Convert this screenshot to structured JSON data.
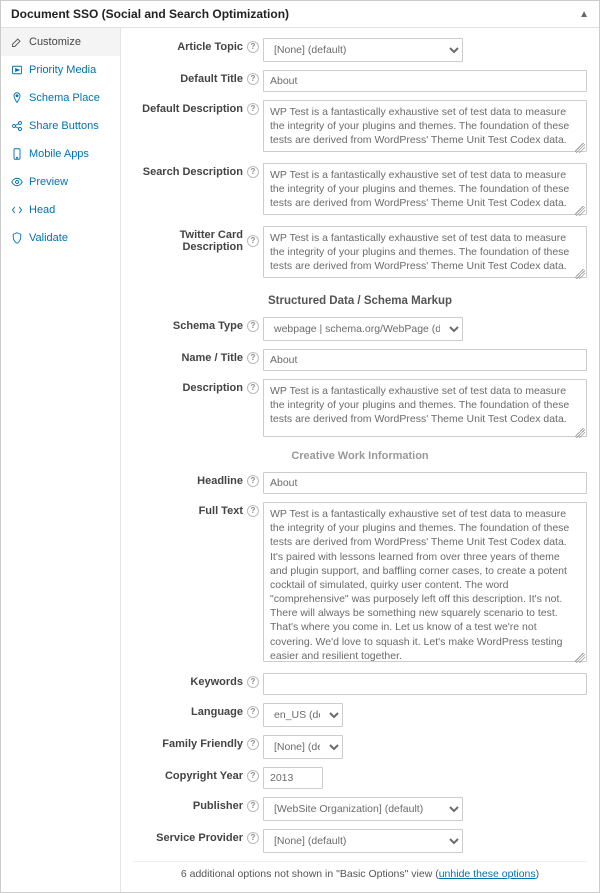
{
  "header": {
    "title": "Document SSO (Social and Search Optimization)"
  },
  "sidebar": {
    "items": [
      {
        "label": "Customize"
      },
      {
        "label": "Priority Media"
      },
      {
        "label": "Schema Place"
      },
      {
        "label": "Share Buttons"
      },
      {
        "label": "Mobile Apps"
      },
      {
        "label": "Preview"
      },
      {
        "label": "Head"
      },
      {
        "label": "Validate"
      }
    ]
  },
  "fields": {
    "article_topic_label": "Article Topic",
    "article_topic_value": "[None] (default)",
    "default_title_label": "Default Title",
    "default_title_value": "About",
    "default_desc_label": "Default Description",
    "default_desc_value": "WP Test is a fantastically exhaustive set of test data to measure the integrity of your plugins and themes. The foundation of these tests are derived from WordPress' Theme Unit Test Codex data.",
    "search_desc_label": "Search Description",
    "search_desc_value": "WP Test is a fantastically exhaustive set of test data to measure the integrity of your plugins and themes. The foundation of these tests are derived from WordPress' Theme Unit Test Codex data.",
    "twitter_desc_label": "Twitter Card Description",
    "twitter_desc_value": "WP Test is a fantastically exhaustive set of test data to measure the integrity of your plugins and themes. The foundation of these tests are derived from WordPress' Theme Unit Test Codex data."
  },
  "schema_section_title": "Structured Data / Schema Markup",
  "schema": {
    "type_label": "Schema Type",
    "type_value": "webpage | schema.org/WebPage (default)",
    "name_label": "Name / Title",
    "name_value": "About",
    "desc_label": "Description",
    "desc_value": "WP Test is a fantastically exhaustive set of test data to measure the integrity of your plugins and themes. The foundation of these tests are derived from WordPress' Theme Unit Test Codex data."
  },
  "creative_section_title": "Creative Work Information",
  "creative": {
    "headline_label": "Headline",
    "headline_value": "About",
    "fulltext_label": "Full Text",
    "fulltext_value": "WP Test is a fantastically exhaustive set of test data to measure the integrity of your plugins and themes. The foundation of these tests are derived from WordPress' Theme Unit Test Codex data. It's paired with lessons learned from over three years of theme and plugin support, and baffling corner cases, to create a potent cocktail of simulated, quirky user content. The word \"comprehensive\" was purposely left off this description. It's not. There will always be something new squarely scenario to test. That's where you come in. Let us know of a test we're not covering. We'd love to squash it. Let's make WordPress testing easier and resilient together.",
    "keywords_label": "Keywords",
    "keywords_value": "",
    "language_label": "Language",
    "language_value": "en_US (default)",
    "family_label": "Family Friendly",
    "family_value": "[None] (default)",
    "copyright_label": "Copyright Year",
    "copyright_value": "2013",
    "publisher_label": "Publisher",
    "publisher_value": "[WebSite Organization] (default)",
    "service_label": "Service Provider",
    "service_value": "[None] (default)"
  },
  "footer": {
    "prefix": "6 additional options not shown in \"Basic Options\" view (",
    "link": "unhide these options",
    "suffix": ")"
  }
}
